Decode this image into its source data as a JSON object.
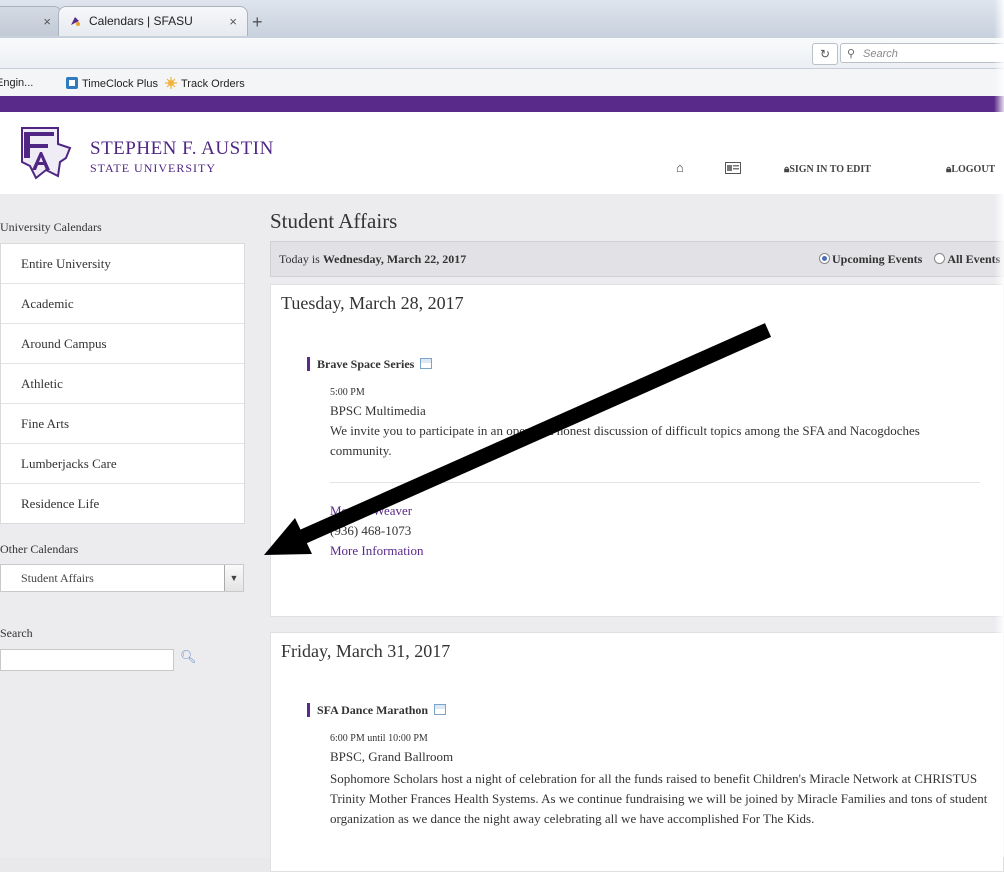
{
  "browser": {
    "tab_active_title": "Calendars | SFASU",
    "new_tab_symbol": "+",
    "close_symbol": "×",
    "search_placeholder": "Search",
    "bookmarks": [
      {
        "label": "Engin..."
      },
      {
        "label": "TimeClock Plus"
      },
      {
        "label": "Track Orders"
      }
    ]
  },
  "site": {
    "name_line1": "STEPHEN F. AUSTIN",
    "name_line2": "STATE UNIVERSITY",
    "nav": {
      "sign_in": "SIGN IN TO EDIT",
      "logout": "LOGOUT"
    }
  },
  "sidebar": {
    "university_heading": "University Calendars",
    "items": [
      {
        "label": "Entire University"
      },
      {
        "label": "Academic"
      },
      {
        "label": "Around Campus"
      },
      {
        "label": "Athletic"
      },
      {
        "label": "Fine Arts"
      },
      {
        "label": "Lumberjacks Care"
      },
      {
        "label": "Residence Life"
      }
    ],
    "other_heading": "Other Calendars",
    "select_value": "Student Affairs",
    "search_heading": "Search"
  },
  "main": {
    "title": "Student Affairs",
    "today_prefix": "Today is",
    "today_date": "Wednesday, March 22, 2017",
    "filter_upcoming": "Upcoming Events",
    "filter_all": "All Events",
    "events": [
      {
        "date": "Tuesday, March 28, 2017",
        "name": "Brave Space Series",
        "time": "5:00 PM",
        "location": "BPSC Multimedia",
        "description": "We invite you to participate in an open and honest discussion of difficult topics among the SFA and Nacogdoches community.",
        "contact": "Monica Weaver",
        "phone": "(936) 468-1073",
        "more": "More Information"
      },
      {
        "date": "Friday, March 31, 2017",
        "name": "SFA Dance Marathon",
        "time": "6:00 PM until 10:00 PM",
        "location": "BPSC, Grand Ballroom",
        "description": "Sophomore Scholars host a night of celebration for all the funds raised to benefit Children's Miracle Network at CHRISTUS Trinity Mother Frances Health Systems. As we continue fundraising we will be joined by Miracle Families and tons of student organization as we dance the night away celebrating all we have accomplished For The Kids."
      }
    ]
  },
  "colors": {
    "brand_purple": "#5a2a8a",
    "arrow": "#000000"
  }
}
